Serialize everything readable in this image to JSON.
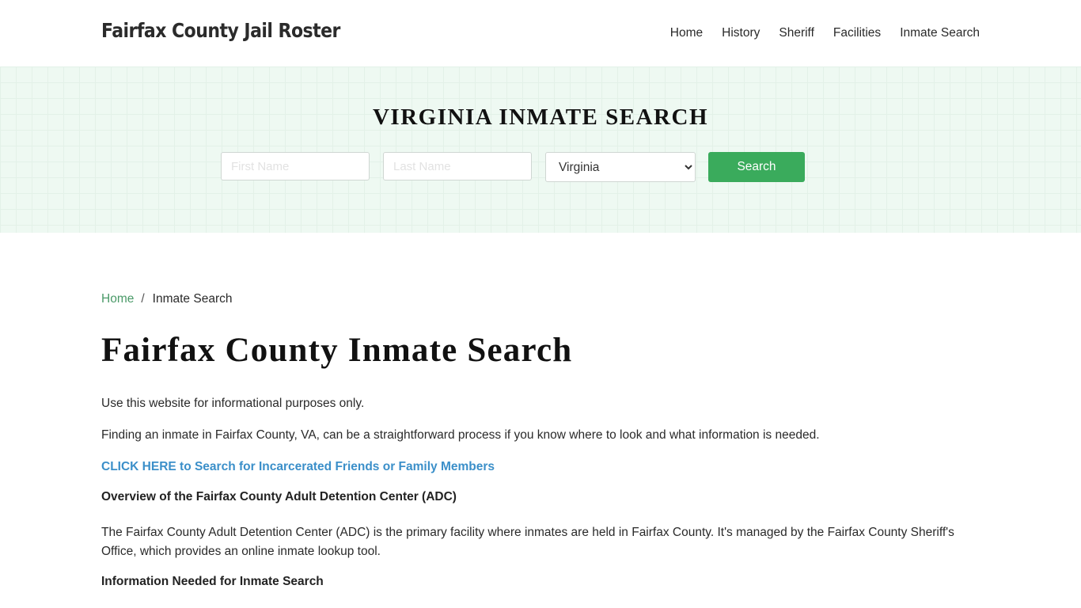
{
  "header": {
    "site_title": "Fairfax County Jail Roster",
    "nav": [
      {
        "label": "Home"
      },
      {
        "label": "History"
      },
      {
        "label": "Sheriff"
      },
      {
        "label": "Facilities"
      },
      {
        "label": "Inmate Search"
      }
    ]
  },
  "hero": {
    "title": "VIRGINIA INMATE SEARCH",
    "first_name_placeholder": "First Name",
    "last_name_placeholder": "Last Name",
    "state_selected": "Virginia",
    "search_label": "Search"
  },
  "breadcrumb": {
    "home": "Home",
    "separator": "/",
    "current": "Inmate Search"
  },
  "main": {
    "title": "Fairfax County Inmate Search",
    "para1": "Use this website for informational purposes only.",
    "para2": "Finding an inmate in Fairfax County, VA, can be a straightforward process if you know where to look and what information is needed.",
    "cta_link": "CLICK HERE to Search for Incarcerated Friends or Family Members",
    "heading1": "Overview of the Fairfax County Adult Detention Center (ADC)",
    "para3": "The Fairfax County Adult Detention Center (ADC) is the primary facility where inmates are held in Fairfax County. It's managed by the Fairfax County Sheriff's Office, which provides an online inmate lookup tool.",
    "heading2": "Information Needed for Inmate Search"
  },
  "colors": {
    "accent_green": "#3aab5c",
    "link_blue": "#3b8fc9",
    "hero_bg": "#eef9f2"
  }
}
